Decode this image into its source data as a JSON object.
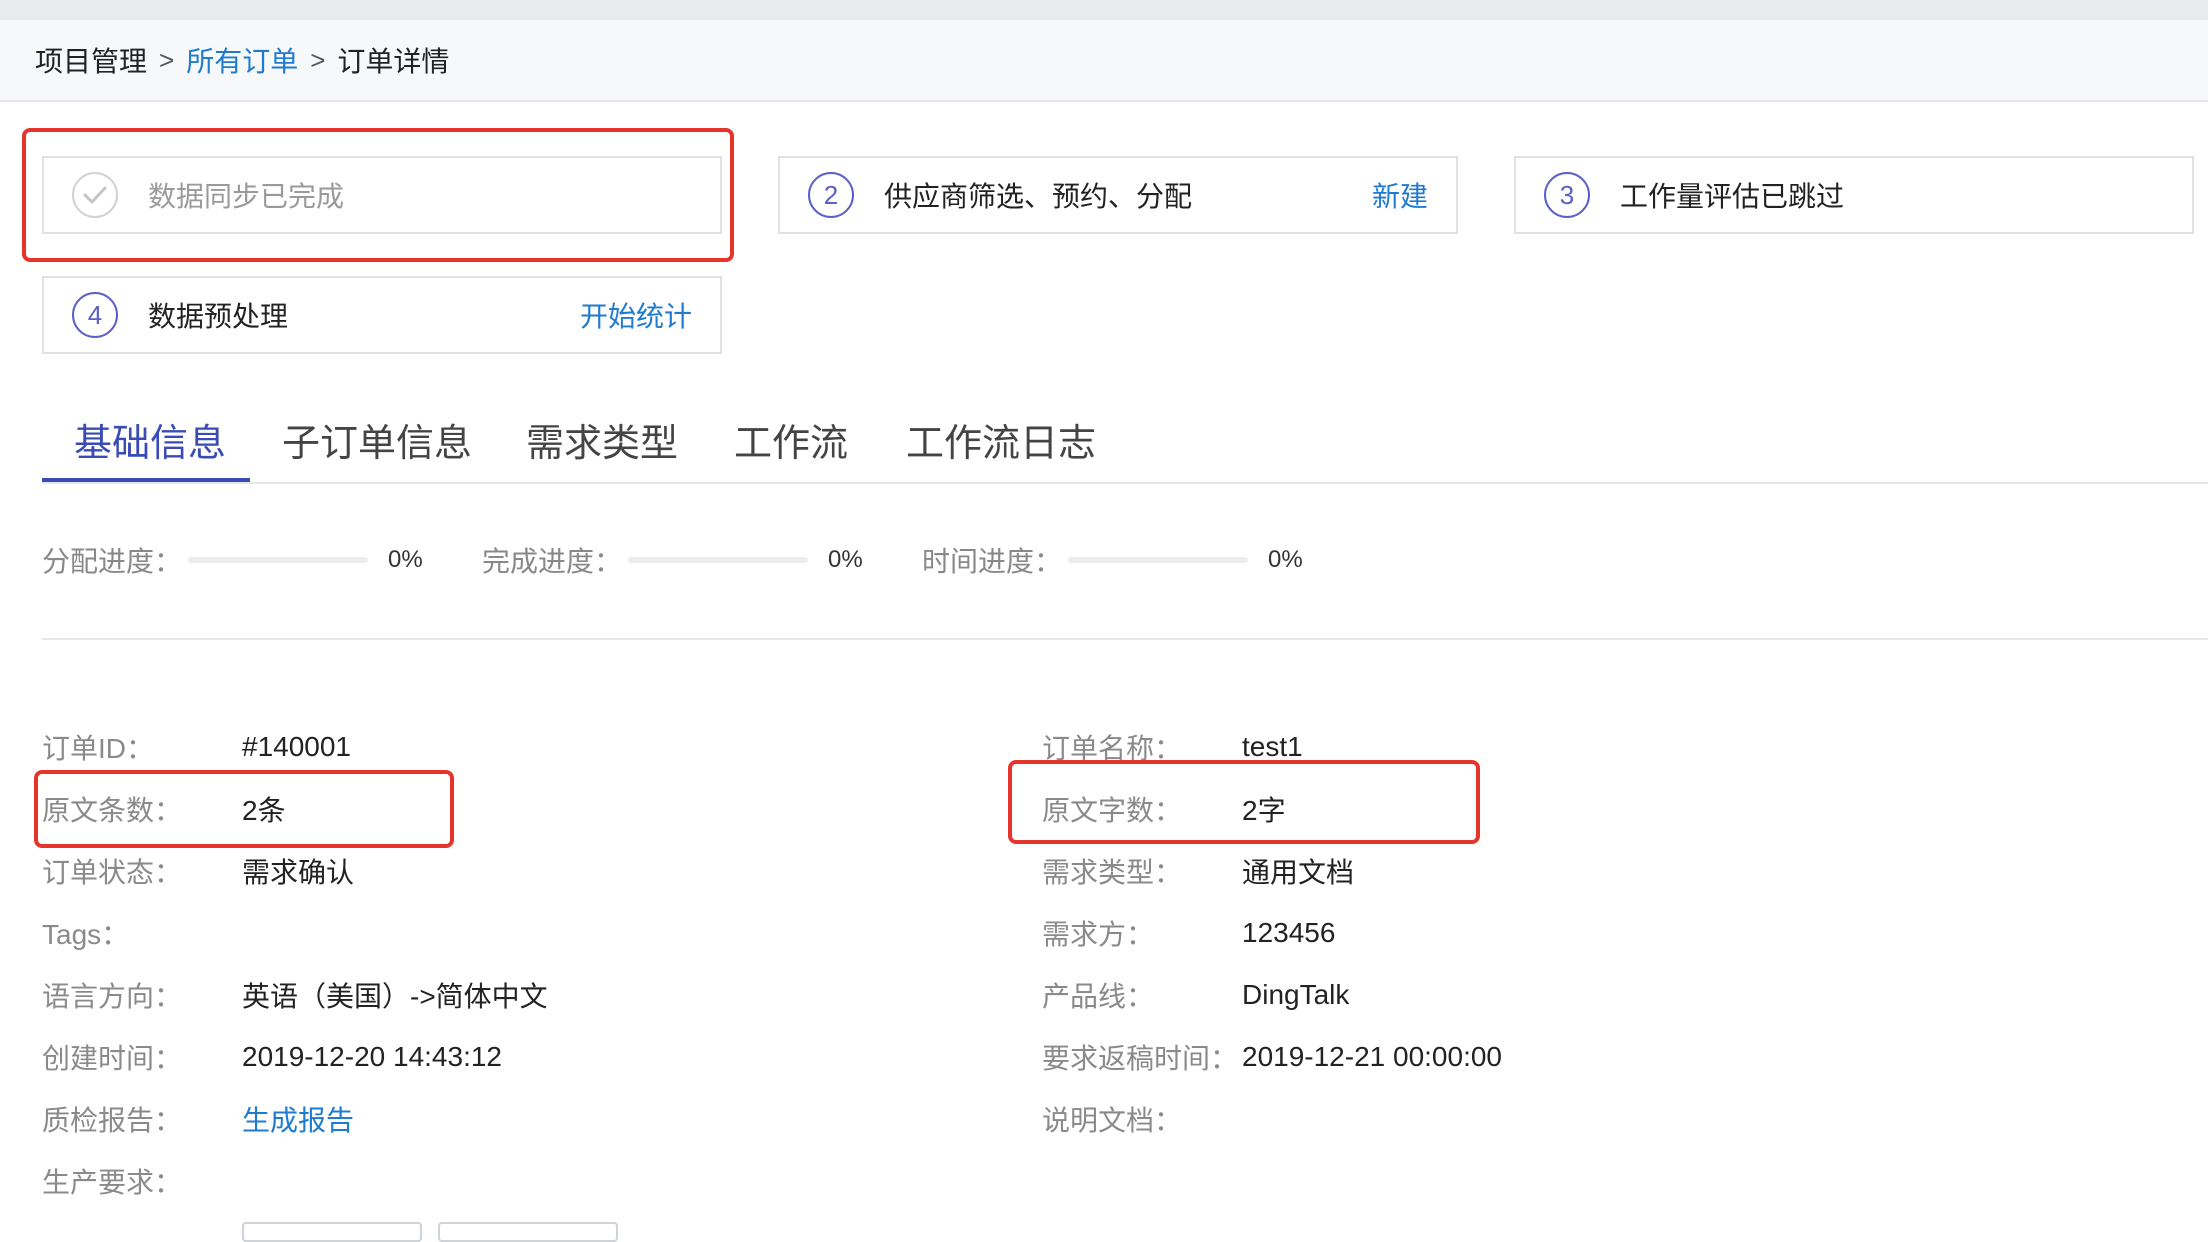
{
  "breadcrumb": {
    "items": [
      "项目管理",
      "所有订单",
      "订单详情"
    ],
    "separator": ">"
  },
  "steps": [
    {
      "label": "数据同步已完成",
      "status": "done"
    },
    {
      "number": "2",
      "label": "供应商筛选、预约、分配",
      "action": "新建"
    },
    {
      "number": "3",
      "label": "工作量评估已跳过"
    },
    {
      "number": "4",
      "label": "数据预处理",
      "action": "开始统计"
    }
  ],
  "tabs": [
    "基础信息",
    "子订单信息",
    "需求类型",
    "工作流",
    "工作流日志"
  ],
  "active_tab": "基础信息",
  "progress": [
    {
      "label": "分配进度：",
      "percent_text": "0%",
      "value": 0
    },
    {
      "label": "完成进度：",
      "percent_text": "0%",
      "value": 0
    },
    {
      "label": "时间进度：",
      "percent_text": "0%",
      "value": 0
    }
  ],
  "info_left": [
    {
      "label": "订单ID：",
      "value": "#140001"
    },
    {
      "label": "原文条数：",
      "value": "2条"
    },
    {
      "label": "订单状态：",
      "value": "需求确认"
    },
    {
      "label": "Tags：",
      "value": ""
    },
    {
      "label": "语言方向：",
      "value": "英语（美国）->简体中文"
    },
    {
      "label": "创建时间：",
      "value": "2019-12-20 14:43:12"
    },
    {
      "label": "质检报告：",
      "value": "生成报告"
    },
    {
      "label": "生产要求：",
      "value": ""
    }
  ],
  "info_right": [
    {
      "label": "订单名称：",
      "value": "test1"
    },
    {
      "label": "原文字数：",
      "value": "2字"
    },
    {
      "label": "需求类型：",
      "value": "通用文档"
    },
    {
      "label": "需求方：",
      "value": "123456"
    },
    {
      "label": "产品线：",
      "value": "DingTalk"
    },
    {
      "label": "要求返稿时间：",
      "value": "2019-12-21 00:00:00"
    },
    {
      "label": "说明文档：",
      "value": ""
    }
  ],
  "colors": {
    "accent": "#3a4bb5",
    "link": "#1f7bd0",
    "highlight_box": "#e5342c"
  },
  "icons": {
    "step1": "check-circle-icon",
    "breadcrumb_separator": "chevron-right-icon"
  }
}
